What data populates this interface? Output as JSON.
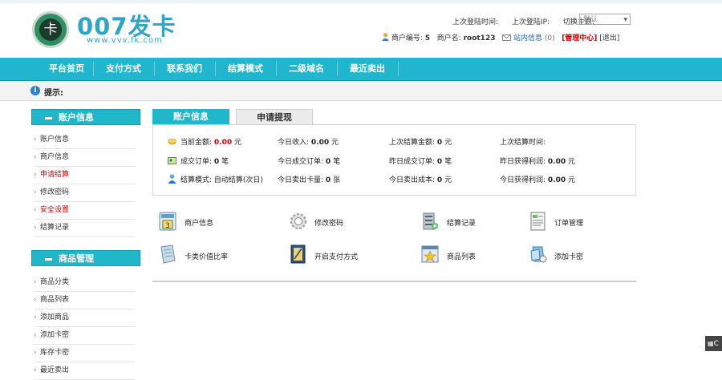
{
  "logo": {
    "title": "007发卡",
    "url": "www.vvv.fk.com",
    "badge": "卡"
  },
  "header": {
    "last_login_time_label": "上次登陆时间:",
    "last_login_ip_label": "上次登陆IP:",
    "theme_label": "切换主题:",
    "theme_value": "默认",
    "merchant_id_label": "商户编号:",
    "merchant_id": "5",
    "merchant_name_label": "商户名:",
    "merchant_name": "root123",
    "inbox_label": "站内信息",
    "inbox_count": "(0)",
    "admin_center": "[管理中心]",
    "logout": "[退出]"
  },
  "nav": [
    "平台首页",
    "支付方式",
    "联系我们",
    "结算模式",
    "二级域名",
    "最近卖出"
  ],
  "tip": {
    "label": "提示:"
  },
  "sidebar": {
    "account_title": "账户信息",
    "account_items": [
      {
        "label": "账户信息",
        "red": false
      },
      {
        "label": "商户信息",
        "red": false
      },
      {
        "label": "申请结算",
        "red": true
      },
      {
        "label": "修改密码",
        "red": false
      },
      {
        "label": "安全设置",
        "red": true
      },
      {
        "label": "结算记录",
        "red": false
      }
    ],
    "goods_title": "商品管理",
    "goods_items": [
      {
        "label": "商品分类"
      },
      {
        "label": "商品列表"
      },
      {
        "label": "添加商品"
      },
      {
        "label": "添加卡密"
      },
      {
        "label": "库存卡密"
      },
      {
        "label": "最近卖出"
      }
    ]
  },
  "tabs": {
    "active": "账户信息",
    "inactive": "申请提现"
  },
  "stats": {
    "row1": [
      {
        "label": "当前金额:",
        "value": "0.00",
        "unit": "元",
        "red": true
      },
      {
        "label": "今日收入:",
        "value": "0.00",
        "unit": "元"
      },
      {
        "label": "上次结算金额:",
        "value": "0",
        "unit": "元"
      },
      {
        "label": "上次结算时间:",
        "value": "",
        "unit": ""
      }
    ],
    "row2": [
      {
        "label": "成交订单:",
        "value": "0",
        "unit": "笔"
      },
      {
        "label": "今日成交订单:",
        "value": "0",
        "unit": "笔"
      },
      {
        "label": "昨日成交订单:",
        "value": "0",
        "unit": "笔"
      },
      {
        "label": "昨日获得利润:",
        "value": "0.00",
        "unit": "元"
      }
    ],
    "row3": [
      {
        "label": "结算模式:",
        "value": "自动结算(次日)",
        "unit": ""
      },
      {
        "label": "今日卖出卡量:",
        "value": "0",
        "unit": "张"
      },
      {
        "label": "今日卖出成本:",
        "value": "0",
        "unit": "元"
      },
      {
        "label": "今日获得利润:",
        "value": "0.00",
        "unit": "元"
      }
    ]
  },
  "quick_links": [
    {
      "label": "商户信息",
      "icon": "merchant-card-icon"
    },
    {
      "label": "修改密码",
      "icon": "gear-icon"
    },
    {
      "label": "结算记录",
      "icon": "database-icon"
    },
    {
      "label": "订单管理",
      "icon": "order-doc-icon"
    },
    {
      "label": "卡类价值比率",
      "icon": "card-ratio-icon"
    },
    {
      "label": "开启支付方式",
      "icon": "payment-book-icon"
    },
    {
      "label": "商品列表",
      "icon": "star-list-icon"
    },
    {
      "label": "添加卡密",
      "icon": "add-card-icon"
    }
  ],
  "float_button": "C"
}
